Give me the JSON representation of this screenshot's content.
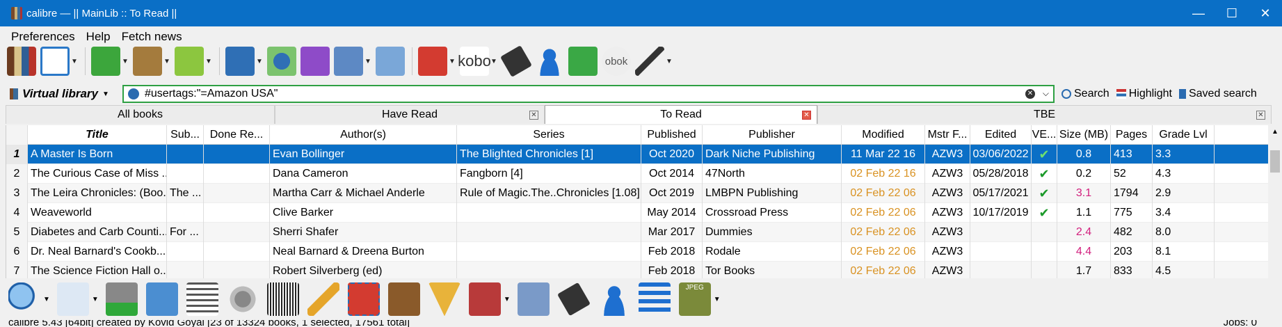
{
  "window": {
    "title": "calibre — || MainLib :: To Read ||",
    "minimize": "—",
    "maximize": "☐",
    "close": "✕"
  },
  "menu": {
    "items": [
      "Preferences",
      "Help",
      "Fetch news"
    ]
  },
  "toolbar": {
    "kobo_label": "kobo",
    "obok_label": "obok",
    "icons": [
      "library-icon",
      "edit-metadata-icon",
      "add-books-icon",
      "convert-books-icon",
      "view-icon",
      "save-to-disk-icon",
      "connect-share-icon",
      "edit-book-icon",
      "annotations-icon",
      "polish-books-icon",
      "remove-books-icon",
      "kobo-icon",
      "tag-icon",
      "user-icon",
      "dice-icon",
      "obok-icon",
      "quill-icon"
    ]
  },
  "search": {
    "virtual_library_label": "Virtual library",
    "query": "#usertags:\"=Amazon USA\"",
    "search_label": "Search",
    "highlight_label": "Highlight",
    "saved_search_label": "Saved search"
  },
  "tabs": [
    {
      "label": "All books",
      "active": false
    },
    {
      "label": "Have Read",
      "active": false
    },
    {
      "label": "To Read",
      "active": true
    },
    {
      "label": "TBE",
      "active": false
    }
  ],
  "table": {
    "columns": [
      "Title",
      "Sub...",
      "Done Re...",
      "Author(s)",
      "Series",
      "Published",
      "Publisher",
      "Modified",
      "Mstr F...",
      "Edited",
      "VE...",
      "Size (MB)",
      "Pages",
      "Grade Lvl"
    ],
    "rows": [
      {
        "num": "1",
        "title": "A Master Is Born",
        "sub": "",
        "done": "",
        "author": "Evan Bollinger",
        "series": "The Blighted Chronicles [1]",
        "published": "Oct 2020",
        "publisher": "Dark Niche Publishing",
        "modified": "11 Mar 22 16",
        "mstr": "AZW3",
        "edited": "03/06/2022",
        "ve": "✔",
        "size": "0.8",
        "pages": "413",
        "grade": "3.3",
        "selected": true,
        "mod_orange": false,
        "size_pink": false
      },
      {
        "num": "2",
        "title": "The Curious Case of Miss ...",
        "sub": "",
        "done": "",
        "author": "Dana Cameron",
        "series": "Fangborn [4]",
        "published": "Oct 2014",
        "publisher": "47North",
        "modified": "02 Feb 22 16",
        "mstr": "AZW3",
        "edited": "05/28/2018",
        "ve": "✔",
        "size": "0.2",
        "pages": "52",
        "grade": "4.3",
        "selected": false,
        "mod_orange": true,
        "size_pink": false
      },
      {
        "num": "3",
        "title": "The Leira Chronicles: (Boo...",
        "sub": "The ...",
        "done": "",
        "author": "Martha Carr & Michael Anderle",
        "series": "Rule of Magic.The..Chronicles [1.08]",
        "published": "Oct 2019",
        "publisher": "LMBPN Publishing",
        "modified": "02 Feb 22 06",
        "mstr": "AZW3",
        "edited": "05/17/2021",
        "ve": "✔",
        "size": "3.1",
        "pages": "1794",
        "grade": "2.9",
        "selected": false,
        "mod_orange": true,
        "size_pink": true
      },
      {
        "num": "4",
        "title": "Weaveworld",
        "sub": "",
        "done": "",
        "author": "Clive Barker",
        "series": "",
        "published": "May 2014",
        "publisher": "Crossroad Press",
        "modified": "02 Feb 22 06",
        "mstr": "AZW3",
        "edited": "10/17/2019",
        "ve": "✔",
        "size": "1.1",
        "pages": "775",
        "grade": "3.4",
        "selected": false,
        "mod_orange": true,
        "size_pink": false
      },
      {
        "num": "5",
        "title": "Diabetes and Carb Counti...",
        "sub": "For ...",
        "done": "",
        "author": "Sherri Shafer",
        "series": "",
        "published": "Mar 2017",
        "publisher": "Dummies",
        "modified": "02 Feb 22 06",
        "mstr": "AZW3",
        "edited": "",
        "ve": "",
        "size": "2.4",
        "pages": "482",
        "grade": "8.0",
        "selected": false,
        "mod_orange": true,
        "size_pink": true
      },
      {
        "num": "6",
        "title": "Dr. Neal Barnard's Cookb...",
        "sub": "",
        "done": "",
        "author": "Neal Barnard & Dreena Burton",
        "series": "",
        "published": "Feb 2018",
        "publisher": "Rodale",
        "modified": "02 Feb 22 06",
        "mstr": "AZW3",
        "edited": "",
        "ve": "",
        "size": "4.4",
        "pages": "203",
        "grade": "8.1",
        "selected": false,
        "mod_orange": true,
        "size_pink": true
      },
      {
        "num": "7",
        "title": "The Science Fiction Hall o...",
        "sub": "",
        "done": "",
        "author": "Robert Silverberg (ed)",
        "series": "",
        "published": "Feb 2018",
        "publisher": "Tor Books",
        "modified": "02 Feb 22 06",
        "mstr": "AZW3",
        "edited": "",
        "ve": "",
        "size": "1.7",
        "pages": "833",
        "grade": "4.5",
        "selected": false,
        "mod_orange": true,
        "size_pink": false
      }
    ]
  },
  "bottom_toolbar": {
    "jpeg_label": "JPEG",
    "icons": [
      "search-books-icon",
      "find-duplicates-icon",
      "check-library-icon",
      "get-books-icon",
      "list-icon",
      "preferences-icon",
      "barcode-add-icon",
      "clean-icon",
      "toolbox-icon",
      "box-arrow-icon",
      "warning-icon",
      "books-icon",
      "image-edit-icon",
      "tag-icon",
      "user-icon",
      "sort-icon",
      "jpeg-icon"
    ]
  },
  "status": {
    "text": "calibre 5.43 [64bit] created by Kovid Goyal    [23 of 13324 books, 1 selected, 17561 total]",
    "jobs": "Jobs: 0"
  },
  "colors": {
    "titlebar": "#0a6fc6",
    "selection": "#0a6fc6",
    "modified": "#d99222",
    "size_alert": "#d2207e",
    "check": "#1c9a2a",
    "search_border": "#2ea043"
  }
}
